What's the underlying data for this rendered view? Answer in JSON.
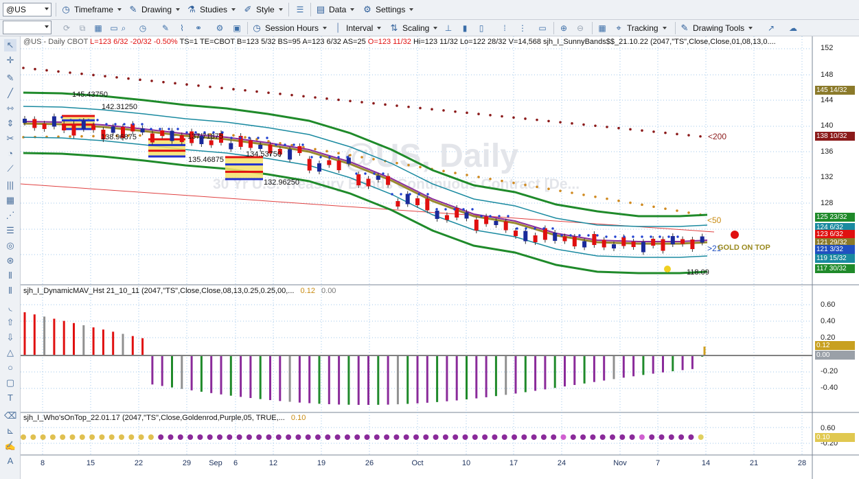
{
  "toolbar1": {
    "symbol_value": "@US",
    "timeframe": "Timeframe",
    "drawing": "Drawing",
    "studies": "Studies",
    "style": "Style",
    "data": "Data",
    "settings": "Settings"
  },
  "toolbar2": {
    "session_hours": "Session Hours",
    "interval": "Interval",
    "scaling": "Scaling",
    "tracking": "Tracking",
    "drawing_tools": "Drawing Tools"
  },
  "price_panel": {
    "header_symbol": "@US - Daily  CBOT",
    "header_low": "L=123 6/32",
    "header_change": "-20/32",
    "header_pct": "-0.50%",
    "header_stats": "TS=1  TE=CBOT  B=123 5/32  BS=95  A=123 6/32  AS=25",
    "header_open": "O=123 11/32",
    "header_rest": "Hi=123 11/32  Lo=122 28/32  V=14,568  sjh_I_SunnyBands$$_21.10.22 (2047,\"TS\",Close,Close,01,08,13,0....",
    "watermark_title": "@US, Daily",
    "watermark_sub": "30 Yr U.S. Treasury Bonds Continuous Contract [De...",
    "annotations": {
      "a1": "145.43750",
      "a2": "142.31250",
      "a3": "138.96875",
      "a4": "137.71875",
      "a5": "135.46875",
      "a6": "134.53750",
      "a7": "132.96250",
      "a8": "118.09",
      "ma200": "<200",
      "ma50": "<50",
      "ma21": ">21",
      "gold": "GOLD ON TOP"
    },
    "y_ticks": [
      "152",
      "148",
      "144",
      "140",
      "136",
      "132",
      "128"
    ],
    "price_labels": [
      {
        "text": "145 14/32",
        "color": "#8b7a2a"
      },
      {
        "text": "138 10/32",
        "color": "#8b1a1a"
      },
      {
        "text": "125 23/32",
        "color": "#1f8a2a"
      },
      {
        "text": "124 6/32",
        "color": "#1a8aa0"
      },
      {
        "text": "123 6/32",
        "color": "#e01010"
      },
      {
        "text": "121 29/32",
        "color": "#8b7a2a"
      },
      {
        "text": "121 3/32",
        "color": "#2050c0"
      },
      {
        "text": "119 15/32",
        "color": "#1a8aa0"
      },
      {
        "text": "117 30/32",
        "color": "#1f8a2a"
      }
    ]
  },
  "dma_panel": {
    "header": "sjh_I_DynamicMAV_Hst 21_10_11 (2047,\"TS\",Close,Close,08,13,0.25,0.25,00,...",
    "val1": "0.12",
    "val2": "0.00",
    "y_ticks": [
      "0.60",
      "0.40",
      "0.20",
      "0.00",
      "-0.20",
      "-0.40"
    ],
    "label": "0.12",
    "zero_label": "0.00"
  },
  "who_panel": {
    "header": "sjh_I_Who'sOnTop_22.01.17 (2047,\"TS\",Close,Goldenrod,Purple,05, TRUE,...",
    "val": "0.10",
    "y_ticks": [
      "0.60",
      "-0.20"
    ],
    "label": "0.10"
  },
  "x_axis": {
    "ticks": [
      "8",
      "15",
      "22",
      "29",
      "Sep",
      "6",
      "12",
      "19",
      "26",
      "Oct",
      "10",
      "17",
      "24",
      "Nov",
      "7",
      "14",
      "21",
      "28"
    ]
  }
}
